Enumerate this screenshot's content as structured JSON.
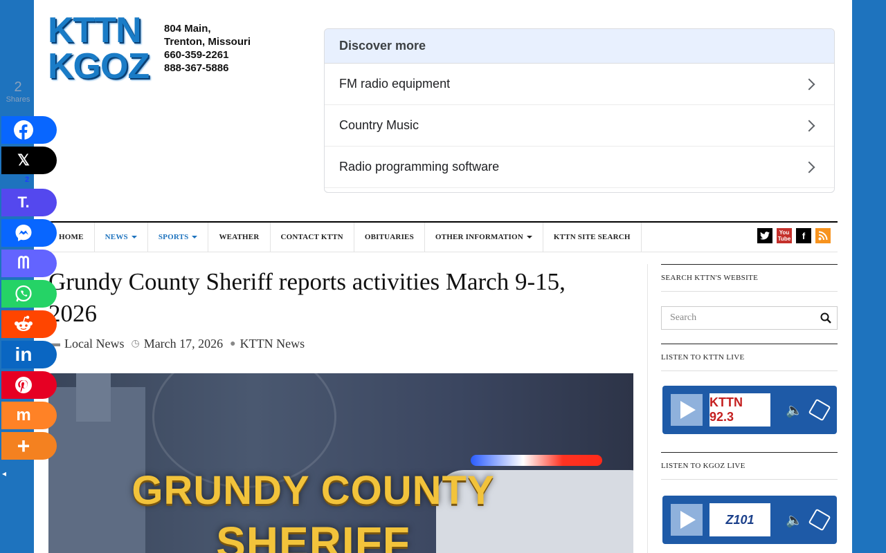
{
  "logo": {
    "line1": "KTTN",
    "line2": "KGOZ",
    "address": "804 Main,",
    "city": "Trenton, Missouri",
    "phone1": "660-359-2261",
    "phone2": "888-367-5886"
  },
  "discover": {
    "title": "Discover more",
    "items": [
      {
        "label": "FM radio equipment"
      },
      {
        "label": "Country Music"
      },
      {
        "label": "Radio programming software"
      }
    ]
  },
  "nav": {
    "items": [
      {
        "label": "HOME"
      },
      {
        "label": "NEWS"
      },
      {
        "label": "SPORTS"
      },
      {
        "label": "WEATHER"
      },
      {
        "label": "CONTACT KTTN"
      },
      {
        "label": "OBITUARIES"
      },
      {
        "label": "OTHER INFORMATION"
      },
      {
        "label": "KTTN SITE SEARCH"
      }
    ],
    "social": [
      {
        "icon": "twitter-icon",
        "color": "#000000"
      },
      {
        "icon": "youtube-icon",
        "color": "#c4302b"
      },
      {
        "icon": "facebook-icon",
        "color": "#000000"
      },
      {
        "icon": "rss-icon",
        "color": "#f7931e"
      }
    ]
  },
  "article": {
    "title": "Grundy County Sheriff reports activities March 9-15, 2026",
    "category": "Local News",
    "date": "March 17, 2026",
    "author": "KTTN News",
    "hero_line1": "GRUNDY COUNTY",
    "hero_line2": "SHERIFF"
  },
  "sidebar": {
    "search_title": "SEARCH KTTN'S WEBSITE",
    "search_placeholder": "Search",
    "kttn_title": "LISTEN TO KTTN LIVE",
    "kttn_station": "KTTN 92.3",
    "kgoz_title": "LISTEN TO KGOZ LIVE",
    "kgoz_station": "Z101"
  },
  "share": {
    "count": "2",
    "count_label": "Shares",
    "threads_count": "2",
    "buttons": [
      {
        "name": "facebook",
        "icon": "facebook-icon",
        "color": "#0866ff"
      },
      {
        "name": "x",
        "icon": "x-icon",
        "color": "#000000"
      },
      {
        "name": "truth",
        "icon": "truth-social-icon",
        "color": "#5448ee"
      },
      {
        "name": "messenger",
        "icon": "messenger-icon",
        "color": "#0866ff"
      },
      {
        "name": "mastodon",
        "icon": "mastodon-icon",
        "color": "#6364ff"
      },
      {
        "name": "whatsapp",
        "icon": "whatsapp-icon",
        "color": "#25d366"
      },
      {
        "name": "reddit",
        "icon": "reddit-icon",
        "color": "#ff4500"
      },
      {
        "name": "linkedin",
        "icon": "linkedin-icon",
        "color": "#0a66c2"
      },
      {
        "name": "pinterest",
        "icon": "pinterest-icon",
        "color": "#e60023"
      },
      {
        "name": "mix",
        "icon": "mix-icon",
        "color": "#ff8226"
      },
      {
        "name": "more",
        "icon": "more-icon",
        "color": "#f48120"
      }
    ]
  }
}
